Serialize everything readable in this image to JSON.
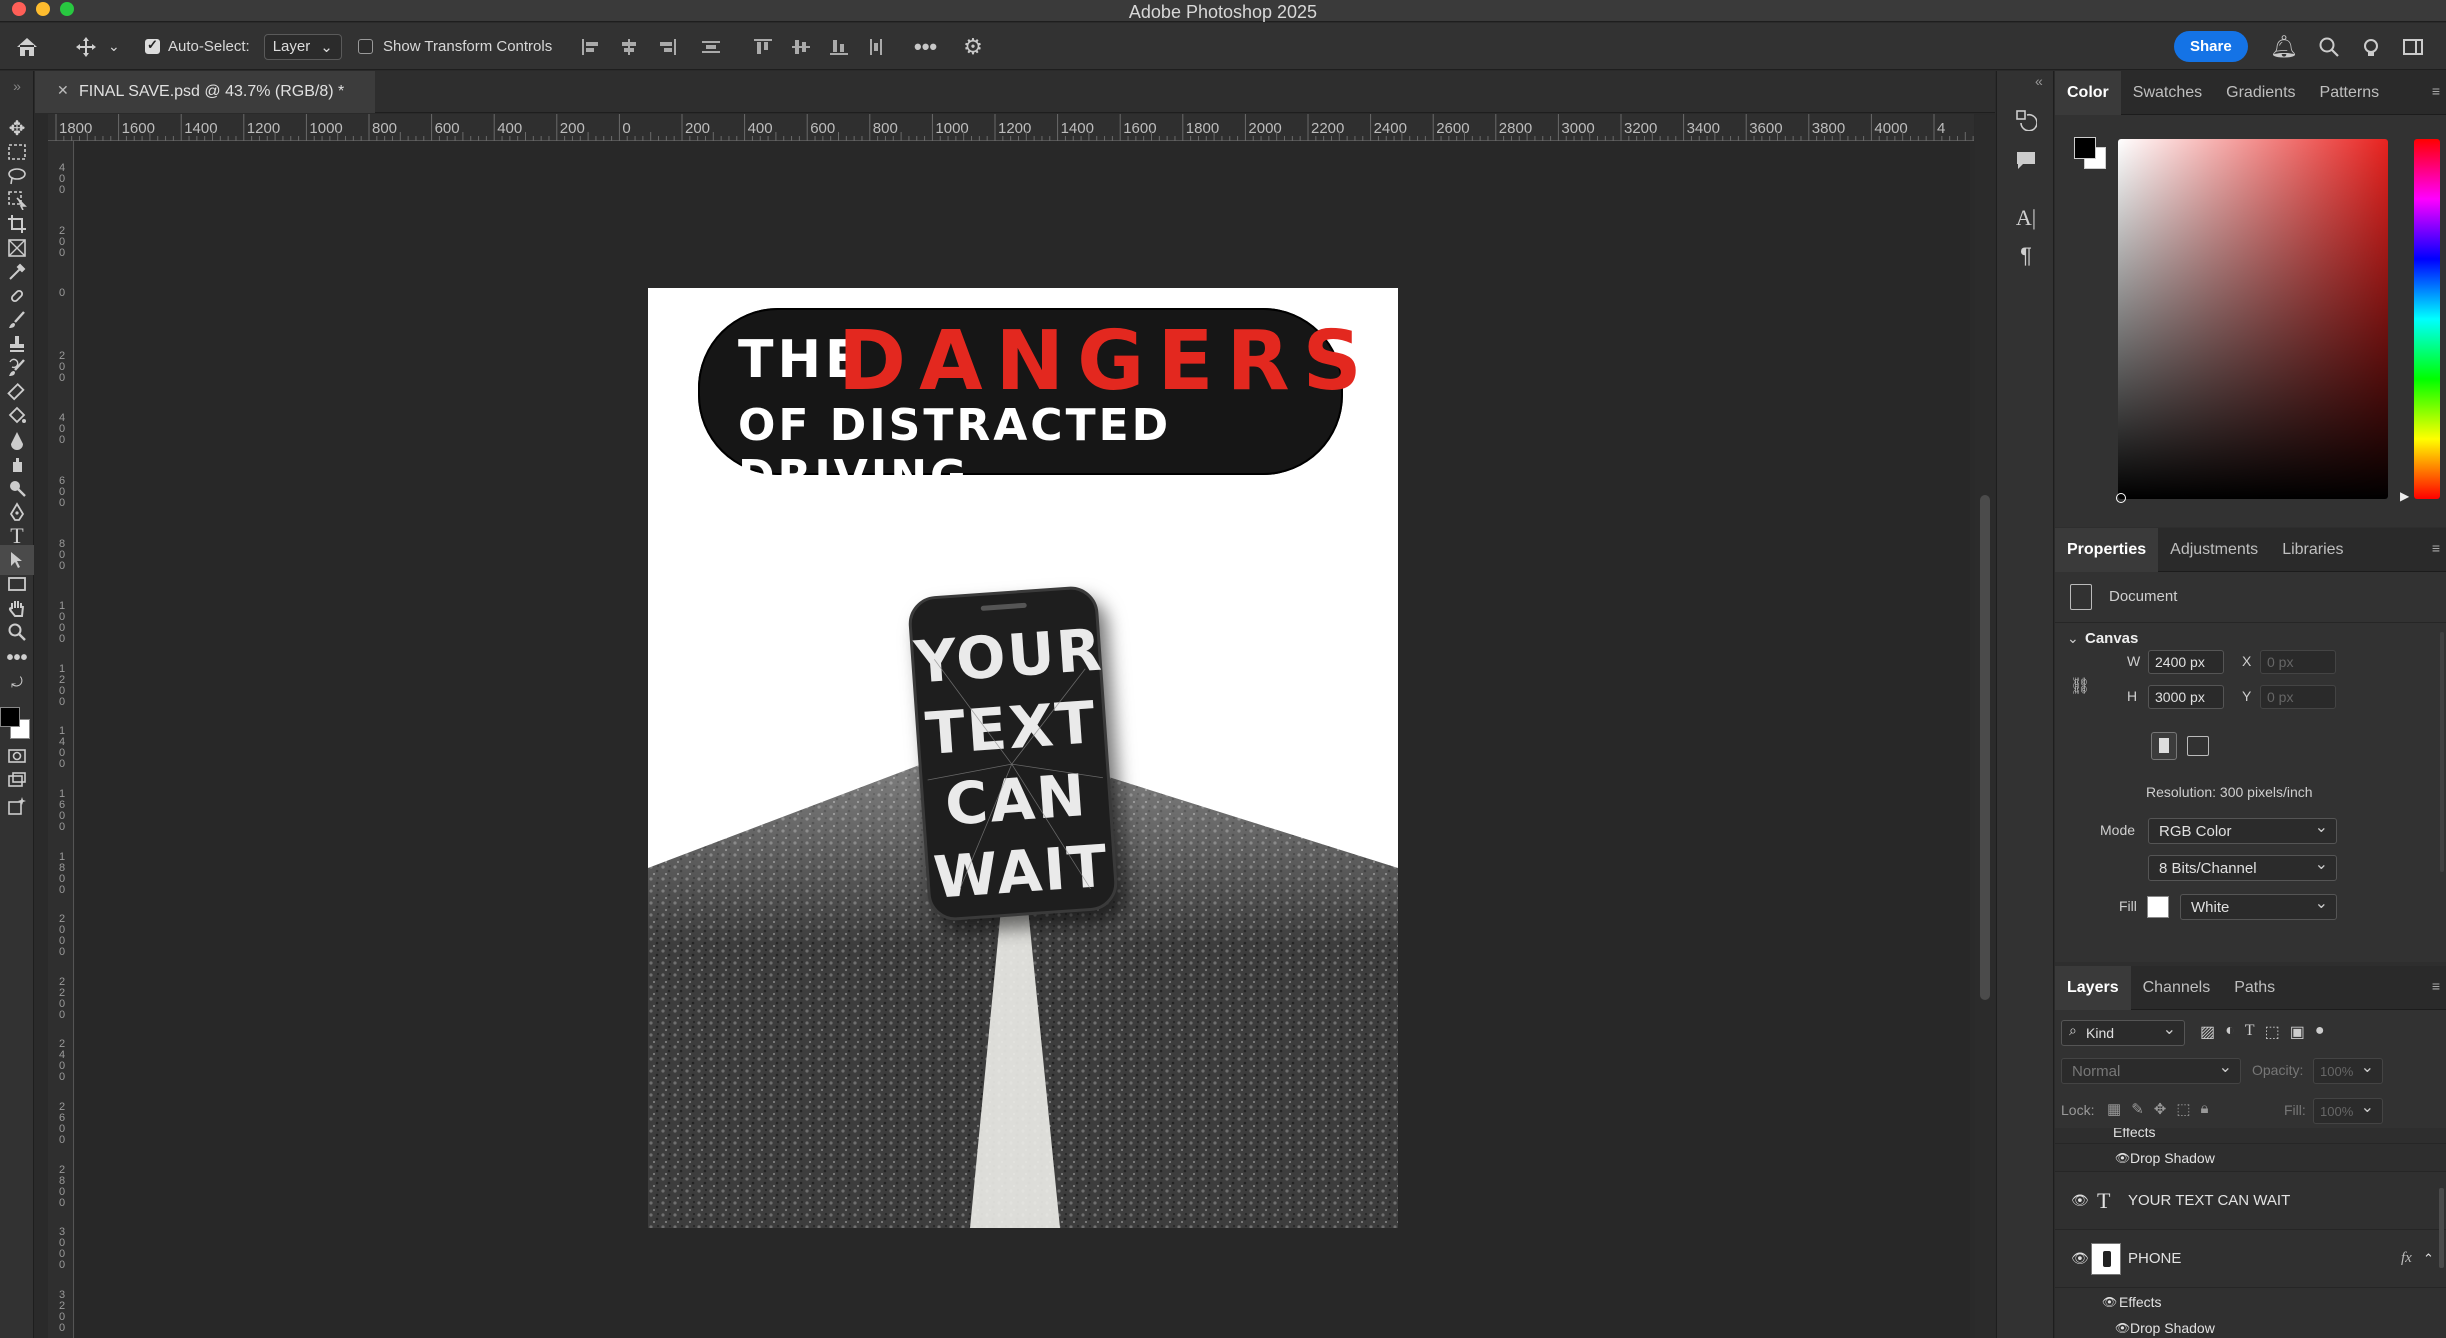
{
  "window": {
    "title": "Adobe Photoshop 2025"
  },
  "options": {
    "auto_select_label": "Auto-Select:",
    "auto_select_value": "Layer",
    "show_transform_label": "Show Transform Controls",
    "share_label": "Share"
  },
  "doc_tab": {
    "title": "FINAL SAVE.psd @ 43.7% (RGB/8) *"
  },
  "ruler": {
    "h_labels": [
      "1800",
      "1600",
      "1400",
      "1200",
      "1000",
      "800",
      "600",
      "400",
      "200",
      "0",
      "200",
      "400",
      "600",
      "800",
      "1000",
      "1200",
      "1400",
      "1600",
      "1800",
      "2000",
      "2200",
      "2400",
      "2600",
      "2800",
      "3000",
      "3200",
      "3400",
      "3600",
      "3800",
      "4000",
      "4"
    ],
    "v_labels": [
      "400",
      "200",
      "0",
      "200",
      "400",
      "600",
      "800",
      "1000",
      "1200",
      "1400",
      "1600",
      "1800",
      "2000",
      "2200",
      "2400",
      "2600",
      "2800",
      "3000",
      "3200"
    ]
  },
  "artwork": {
    "banner_the": "THE",
    "banner_dangers": "DANGERS",
    "banner_sub": "OF DISTRACTED DRIVING",
    "phone_lines": [
      "YOUR",
      "TEXT",
      "CAN",
      "WAIT"
    ]
  },
  "color_panel": {
    "tabs": [
      "Color",
      "Swatches",
      "Gradients",
      "Patterns"
    ],
    "fg": "#000000",
    "bg": "#ffffff",
    "hue_color": "#e8221f"
  },
  "properties": {
    "tabs": [
      "Properties",
      "Adjustments",
      "Libraries"
    ],
    "doc_label": "Document",
    "canvas_label": "Canvas",
    "w_label": "W",
    "w_value": "2400 px",
    "h_label": "H",
    "h_value": "3000 px",
    "x_label": "X",
    "x_placeholder": "0 px",
    "y_label": "Y",
    "y_placeholder": "0 px",
    "resolution": "Resolution: 300 pixels/inch",
    "mode_label": "Mode",
    "mode_value": "RGB Color",
    "bits_value": "8 Bits/Channel",
    "fill_label": "Fill",
    "fill_value": "White"
  },
  "layers": {
    "tabs": [
      "Layers",
      "Channels",
      "Paths"
    ],
    "kind": "Kind",
    "blend": "Normal",
    "opacity_label": "Opacity:",
    "opacity_value": "100%",
    "lock_label": "Lock:",
    "fill_label": "Fill:",
    "fill_value": "100%",
    "rows": [
      {
        "name": "Effects",
        "type": "effects"
      },
      {
        "name": "Drop Shadow",
        "type": "effect"
      },
      {
        "name": "YOUR TEXT CAN WAIT",
        "type": "text"
      },
      {
        "name": "PHONE",
        "type": "smart",
        "fx": "fx"
      },
      {
        "name": "Effects",
        "type": "effects"
      },
      {
        "name": "Drop Shadow",
        "type": "effect"
      }
    ]
  }
}
